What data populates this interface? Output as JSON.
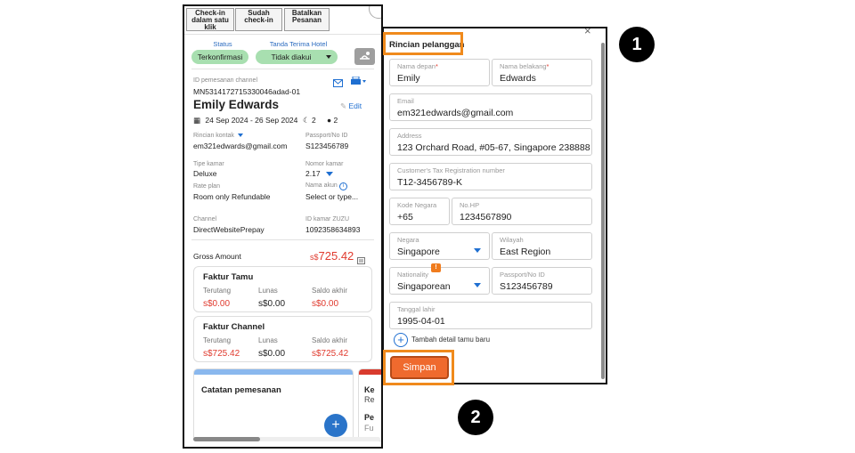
{
  "booking_panel": {
    "top_buttons": {
      "checkin_one_click": "Check-in dalam satu klik",
      "checked_in": "Sudah check-in",
      "cancel_order": "Batalkan Pesanan"
    },
    "status_label": "Status",
    "status_value": "Terkonfirmasi",
    "hotel_receipt_label": "Tanda Terima Hotel",
    "hotel_receipt_value": "Tidak diakui",
    "channel_booking_id_label": "ID pemesanan channel",
    "channel_booking_id": "MN5314172715330046adad-01",
    "guest_name": "Emily Edwards",
    "edit_label": "Edit",
    "dates": "24 Sep 2024 - 26 Sep 2024",
    "nights": "2",
    "guests": "2",
    "contact_label": "Rincian kontak",
    "contact_value": "em321edwards@gmail.com",
    "passport_label": "Passport/No ID",
    "passport_value": "S123456789",
    "room_type_label": "Tipe kamar",
    "room_type_value": "Deluxe",
    "room_number_label": "Nomor kamar",
    "room_number_value": "2.17",
    "rate_plan_label": "Rate plan",
    "rate_plan_value": "Room only Refundable",
    "account_name_label": "Nama akun",
    "account_name_value": "Select or type...",
    "channel_label": "Channel",
    "channel_value": "DirectWebsitePrepay",
    "zuzu_id_label": "ID kamar ZUZU",
    "zuzu_id_value": "1092358634893",
    "gross_amount_label": "Gross Amount",
    "gross_amount_currency": "s$",
    "gross_amount_value": "725.42",
    "guest_invoice": {
      "title": "Faktur Tamu",
      "outstanding_label": "Terutang",
      "paid_label": "Lunas",
      "balance_label": "Saldo akhir",
      "outstanding": "s$0.00",
      "paid": "s$0.00",
      "balance": "s$0.00"
    },
    "channel_invoice": {
      "title": "Faktur Channel",
      "outstanding_label": "Terutang",
      "paid_label": "Lunas",
      "balance_label": "Saldo akhir",
      "outstanding": "s$725.42",
      "paid": "s$0.00",
      "balance": "s$725.42"
    },
    "notes_title": "Catatan pemesanan",
    "partial_card": {
      "line1": "Ke",
      "line2": "Re",
      "line3": "Pe",
      "line4": "Fu"
    },
    "add_button": "+"
  },
  "guest_form": {
    "title": "Rincian pelanggan",
    "close": "×",
    "first_name_label": "Nama depan",
    "first_name": "Emily",
    "last_name_label": "Nama belakang",
    "last_name": "Edwards",
    "required_mark": "*",
    "email_label": "Email",
    "email": "em321edwards@gmail.com",
    "address_label": "Address",
    "address": "123 Orchard Road, #05-67, Singapore 238888",
    "tax_label": "Customer's Tax Registration number",
    "tax_value": "T12-3456789-K",
    "country_code_label": "Kode Negara",
    "country_code": "+65",
    "phone_label": "No.HP",
    "phone": "1234567890",
    "country_label": "Negara",
    "country": "Singapore",
    "region_label": "Wilayah",
    "region": "East Region",
    "nationality_label": "Nationality",
    "nationality": "Singaporean",
    "passport_label": "Passport/No ID",
    "passport": "S123456789",
    "dob_label": "Tanggal lahir",
    "dob": "1995-04-01",
    "add_guest_label": "Tambah detail tamu baru",
    "save_button": "Simpan"
  },
  "step_badges": {
    "one": "1",
    "two": "2"
  },
  "colors": {
    "orange_highlight": "#f08a1c",
    "save_button": "#ef6a2e",
    "status_pill": "#a8dfb0",
    "link_blue": "#1f6fd1",
    "amount_red": "#e03a2e"
  }
}
